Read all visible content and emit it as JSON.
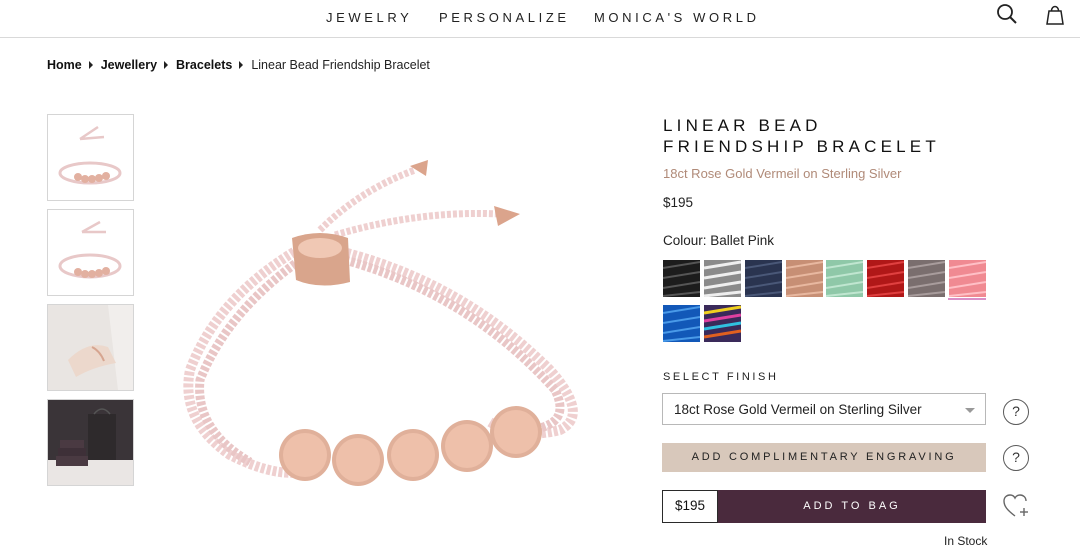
{
  "nav": {
    "items": [
      "JEWELRY",
      "PERSONALIZE",
      "MONICA'S WORLD"
    ],
    "search_icon": "search-icon",
    "bag_icon": "shopping-bag-icon"
  },
  "breadcrumb": {
    "links": [
      "Home",
      "Jewellery",
      "Bracelets"
    ],
    "current": "Linear Bead Friendship Bracelet"
  },
  "thumbnails": [
    "bracelet-front",
    "bracelet-angle",
    "bracelet-on-wrist",
    "gift-packaging"
  ],
  "product": {
    "title_line1": "LINEAR BEAD",
    "title_line2": "FRIENDSHIP BRACELET",
    "subtitle": "18ct Rose Gold Vermeil on Sterling Silver",
    "price": "$195",
    "colour_label": "Colour: Ballet Pink",
    "swatches": [
      {
        "name": "black",
        "color": "#1c1c1c"
      },
      {
        "name": "black-white",
        "color": "#8a8a8a"
      },
      {
        "name": "navy",
        "color": "#2a3450"
      },
      {
        "name": "copper",
        "color": "#c78f75"
      },
      {
        "name": "mint",
        "color": "#8fc8a8"
      },
      {
        "name": "red",
        "color": "#b01818"
      },
      {
        "name": "grey",
        "color": "#7a6e6e"
      },
      {
        "name": "ballet-pink",
        "color": "#f08a92",
        "selected": true
      },
      {
        "name": "blue",
        "color": "#1258b8"
      },
      {
        "name": "rainbow",
        "color": "#6a3a8a"
      }
    ],
    "finish_label": "SELECT FINISH",
    "finish_value": "18ct Rose Gold Vermeil on Sterling Silver",
    "help_glyph": "?",
    "engraving_label": "ADD COMPLIMENTARY ENGRAVING",
    "bag_price": "$195",
    "add_to_bag_label": "ADD TO BAG",
    "wishlist_icon": "heart-plus-icon",
    "stock_status": "In Stock"
  },
  "colors": {
    "accent_bag": "#4a2a3d",
    "engrave_bg": "#d8c8bb",
    "subtitle": "#b08a78"
  }
}
